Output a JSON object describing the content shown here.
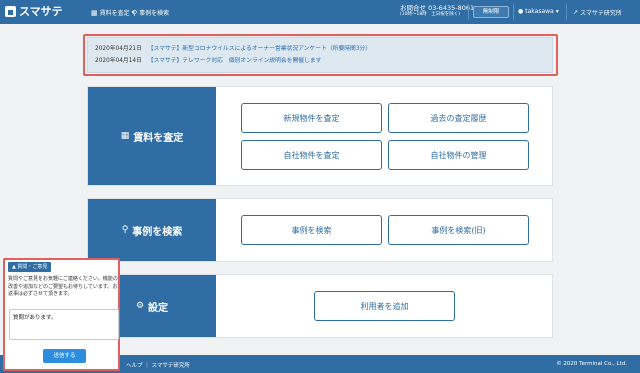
{
  "header": {
    "brand": "スマサテ",
    "nav": [
      {
        "icon": "calculator-icon",
        "label": "賃料を査定",
        "caret": "▾"
      },
      {
        "icon": "search-icon",
        "label": "事例を検索"
      }
    ],
    "contact_label": "お問合せ 03-6435-8061",
    "contact_hours": "(10時〜18時　土日祝を除く)",
    "plan_badge": "無制限",
    "user": "takasawa",
    "user_caret": "▾",
    "company": "スマサテ研究所"
  },
  "notices": [
    {
      "date": "2020年04月21日",
      "text": "【スマサテ】新型コロナウイルスによるオーナー営業状況アンケート（所要時間3分）"
    },
    {
      "date": "2020年04月14日",
      "text": "【スマサテ】テレワーク対応　個別オンライン説明会を開催します"
    }
  ],
  "sections": {
    "appraise": {
      "title": "賃料を査定",
      "icon": "calculator-icon",
      "buttons": [
        "新規物件を査定",
        "過去の査定履歴",
        "自社物件を査定",
        "自社物件の管理"
      ]
    },
    "search": {
      "title": "事例を検索",
      "icon": "search-icon",
      "buttons": [
        "事例を検索",
        "事例を検索(旧)"
      ]
    },
    "settings": {
      "title": "設定",
      "icon": "gear-icon",
      "buttons": [
        "利用者を追加"
      ]
    }
  },
  "footer": {
    "links": "ヘルプ ｜ スマサテ研究所",
    "copyright": "© 2020 Terminal Co., Ltd."
  },
  "feedback": {
    "tab_label": "▲ 質問・ご意見",
    "message": "質問やご意見をお気軽にご連絡ください。機能の改善や追加などのご要望もお待ちしています。お返事は必ずさせて頂きます。",
    "textarea_value": "質問があります。",
    "send_label": "送信する"
  }
}
